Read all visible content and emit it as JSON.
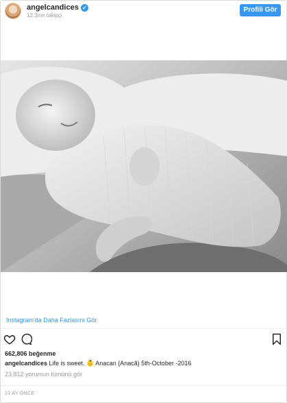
{
  "header": {
    "username": "angelcandices",
    "followers": "12.3mn takipçi",
    "profile_button": "Profili Gör"
  },
  "more_link": "Instagram'da Daha Fazlasını Gör",
  "likes": "662,806 beğenme",
  "caption": {
    "username": "angelcandices",
    "text": " Life is sweet. 👶 Anacan (Anacã) 5th-October -2016"
  },
  "comments_link": "23,812 yorumun tümünü gör",
  "timestamp": "21 AY ÖNCE",
  "colors": {
    "accent": "#3897f0",
    "text": "#262626",
    "muted": "#999999"
  },
  "icons": [
    "verified-badge-icon",
    "heart-icon",
    "comment-icon",
    "bookmark-icon"
  ]
}
